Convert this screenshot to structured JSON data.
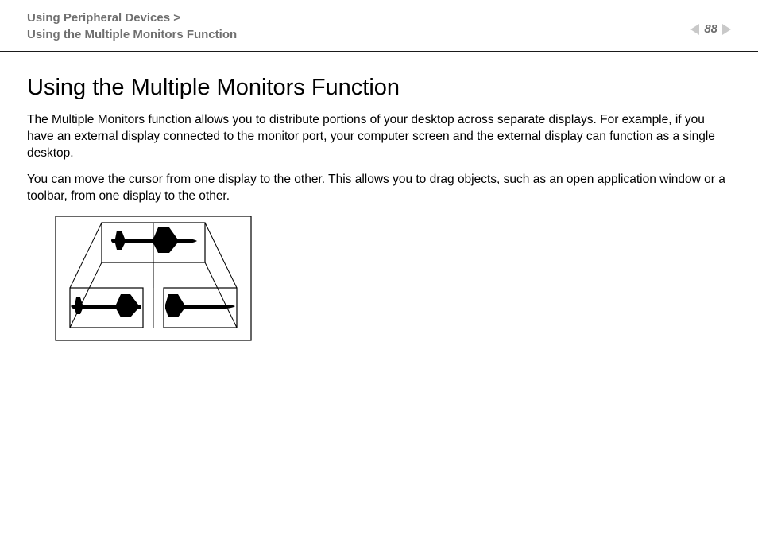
{
  "header": {
    "breadcrumb_parent": "Using Peripheral Devices >",
    "breadcrumb_current": "Using the Multiple Monitors Function",
    "page_number": "88"
  },
  "main": {
    "heading": "Using the Multiple Monitors Function",
    "para1": "The Multiple Monitors function allows you to distribute portions of your desktop across separate displays. For example, if you have an external display connected to the monitor port, your computer screen and the external display can function as a single desktop.",
    "para2": "You can move the cursor from one display to the other. This allows you to drag objects, such as an open application window or a toolbar, from one display to the other."
  }
}
